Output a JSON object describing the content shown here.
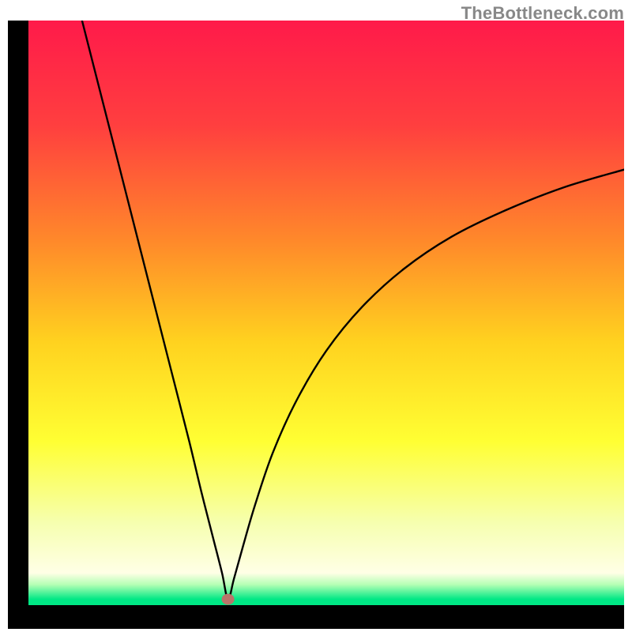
{
  "watermark": "TheBottleneck.com",
  "chart_data": {
    "type": "line",
    "title": "",
    "xlabel": "",
    "ylabel": "",
    "xlim": [
      0,
      100
    ],
    "ylim": [
      0,
      100
    ],
    "grid": false,
    "legend": false,
    "gradient_stops": [
      {
        "pos": 0.0,
        "color": "#ff1a4a"
      },
      {
        "pos": 0.18,
        "color": "#ff3f3f"
      },
      {
        "pos": 0.38,
        "color": "#ff8a2a"
      },
      {
        "pos": 0.55,
        "color": "#ffd21f"
      },
      {
        "pos": 0.72,
        "color": "#ffff33"
      },
      {
        "pos": 0.86,
        "color": "#f6ffb0"
      },
      {
        "pos": 0.945,
        "color": "#ffffe6"
      },
      {
        "pos": 0.965,
        "color": "#b4ffb4"
      },
      {
        "pos": 0.99,
        "color": "#00e885"
      },
      {
        "pos": 1.0,
        "color": "#00e885"
      }
    ],
    "marker": {
      "x": 33.5,
      "y": 1.0,
      "color": "#b9756a"
    },
    "series": [
      {
        "name": "bottleneck-curve",
        "x": [
          9.0,
          12.0,
          15.0,
          18.0,
          21.0,
          24.0,
          27.0,
          29.0,
          31.0,
          32.5,
          33.5,
          34.5,
          36.0,
          38.0,
          41.0,
          45.0,
          50.0,
          56.0,
          63.0,
          71.0,
          80.0,
          90.0,
          100.0
        ],
        "y": [
          100.0,
          88.0,
          76.0,
          64.0,
          52.0,
          40.0,
          28.0,
          19.5,
          11.5,
          5.5,
          1.0,
          4.5,
          10.0,
          17.0,
          26.0,
          35.0,
          43.5,
          51.0,
          57.5,
          63.0,
          67.5,
          71.5,
          74.5
        ]
      }
    ]
  }
}
